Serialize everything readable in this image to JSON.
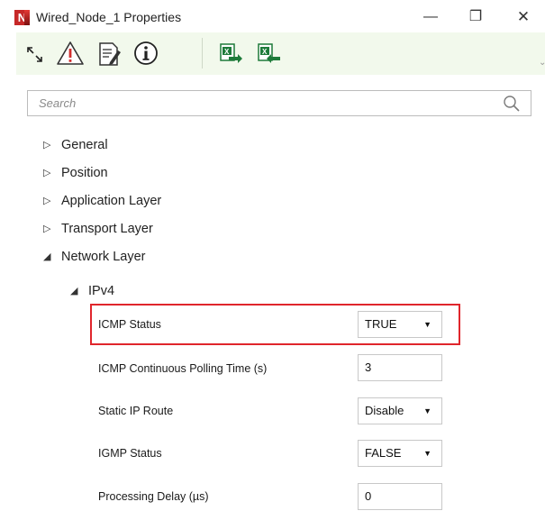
{
  "window": {
    "title": "Wired_Node_1 Properties",
    "logo_letter": "N",
    "minimize_glyph": "—",
    "maximize_glyph": "❐",
    "close_glyph": "✕"
  },
  "toolbar": {
    "buttons": [
      {
        "name": "expand-arrows-icon"
      },
      {
        "name": "warning-icon"
      },
      {
        "name": "notes-edit-icon"
      },
      {
        "name": "info-icon"
      },
      {
        "name": "excel-export-icon"
      },
      {
        "name": "excel-import-icon"
      }
    ]
  },
  "search": {
    "placeholder": "Search",
    "value": ""
  },
  "tree": {
    "collapsed_arrow": "▷",
    "expanded_arrow": "◢",
    "items": [
      {
        "label": "General",
        "expanded": false
      },
      {
        "label": "Position",
        "expanded": false
      },
      {
        "label": "Application Layer",
        "expanded": false
      },
      {
        "label": "Transport Layer",
        "expanded": false
      },
      {
        "label": "Network Layer",
        "expanded": true
      }
    ],
    "subitem": {
      "label": "IPv4",
      "expanded": true
    }
  },
  "properties": [
    {
      "label": "ICMP Status",
      "type": "select",
      "value": "TRUE",
      "highlighted": true
    },
    {
      "label": "ICMP Continuous Polling Time (s)",
      "type": "input",
      "value": "3"
    },
    {
      "label": "Static IP Route",
      "type": "select",
      "value": "Disable"
    },
    {
      "label": "IGMP Status",
      "type": "select",
      "value": "FALSE"
    },
    {
      "label": "Processing Delay (µs)",
      "type": "input",
      "value": "0"
    }
  ],
  "colors": {
    "toolbar_bg": "#f2f9ec",
    "highlight_border": "#e0262c",
    "logo": "#c62828"
  }
}
